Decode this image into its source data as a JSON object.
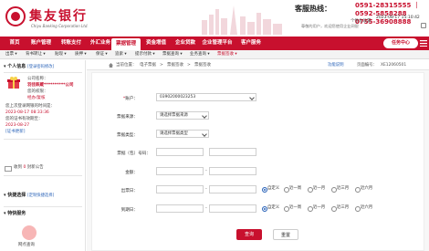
{
  "header": {
    "bank_name": "集友银行",
    "bank_name_en": "Chiyu Banking Corporation Ltd.",
    "hotline_label": "客服热线：",
    "hotline_1": "0591-28315555 ｜ 0592-5858288",
    "hotline_2": "0755-36908888",
    "customize": "个性化设置",
    "greeting": "尊敬的用户，欢迎您使用企业网银",
    "datetime": "2023-08-17 15:10:42"
  },
  "nav": {
    "items": [
      "首页",
      "账户管理",
      "转账支付",
      "外汇业务",
      "票据管理",
      "资金增值",
      "企业贷款",
      "企业管理平台",
      "客户服务"
    ],
    "active_index": 4,
    "task_center": "任务中心"
  },
  "subnav": {
    "items": [
      "出票 ▾",
      "背书转让 ▾",
      "贴现 ▾",
      "质押 ▾",
      "保证 ▾",
      "追索 ▾",
      "提示付款 ▾",
      "票据查询 ▾",
      "业务查询 ▾",
      "票据签收 ▾"
    ],
    "active_index": 9
  },
  "sidebar": {
    "personal_title": "个人信息",
    "personal_link": "[登录密码修改]",
    "company_label": "公司名称：",
    "company_value": "羽佳跌蔵**********公司",
    "title_label": "您的权限：",
    "title_value": "经办/复核",
    "last_login_label": "您上次登录网银的时间是：",
    "last_login_value": "2023-08-17 08:33:36",
    "cert_label": "您的证书有效期至：",
    "cert_value": "2023-08-27",
    "cert_link": "[证书更新]",
    "inbox_text_pre": "收到 ",
    "inbox_count": "0",
    "inbox_text_post": " 封新公告",
    "quick_title": "快捷选择",
    "quick_link": "[定制快捷选择]",
    "svc_title": "特快服务",
    "svc_item": "网点查询"
  },
  "main": {
    "crumb_label": "当前位置：",
    "crumb": [
      "电子票据",
      "票据签收",
      "票据签收"
    ],
    "feature_link": "功能说明",
    "page_id_label": "页面编号：",
    "page_id": "XE12060501",
    "form": {
      "account_label": "账户：",
      "account_value": "03902000023253",
      "type_label": "票据来源：",
      "type_placeholder": "请选择票据来源",
      "kind_label": "票据类型：",
      "kind_placeholder": "请选择票据类型",
      "bill_no_label": "票据（包）号码：",
      "amount_label": "金额：",
      "issue_label": "出票日：",
      "due_label": "到期日：",
      "radios": [
        "自定义",
        "近一周",
        "近一月",
        "近三月",
        "近六月"
      ],
      "query_button": "查询",
      "reset_button": "重置"
    }
  }
}
